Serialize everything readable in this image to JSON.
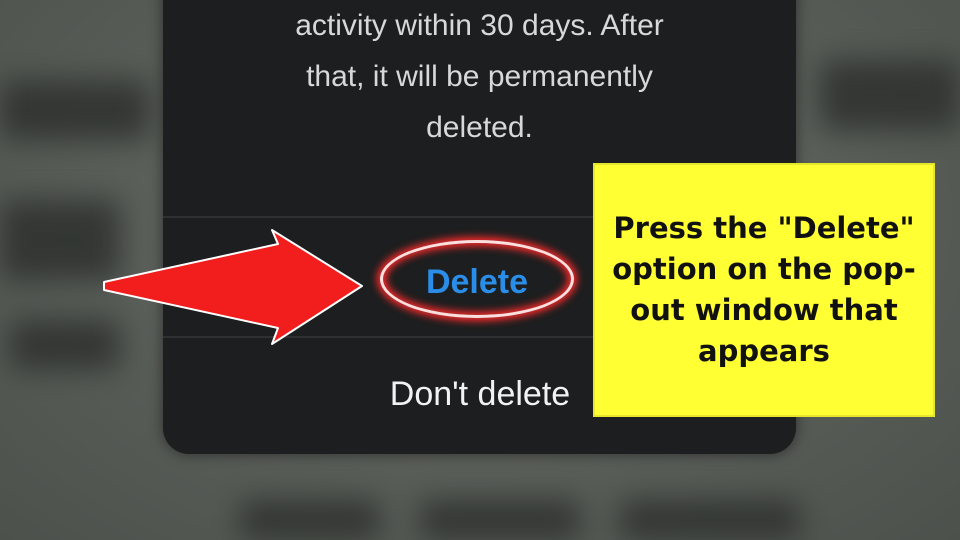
{
  "dialog": {
    "body_lines": [
      "activity within 30 days. After",
      "that, it will be permanently",
      "deleted."
    ],
    "delete_label": "Delete",
    "dont_delete_label": "Don't delete"
  },
  "annotation": {
    "callout_text": "Press the \"Delete\" option on the pop-out window that appears",
    "arrow_icon": "red-arrow-icon",
    "highlight_color": "#ff2b2b",
    "callout_color": "#ffff33"
  },
  "colors": {
    "dialog_bg": "#1d1e1f",
    "delete_text": "#2a8de8"
  }
}
